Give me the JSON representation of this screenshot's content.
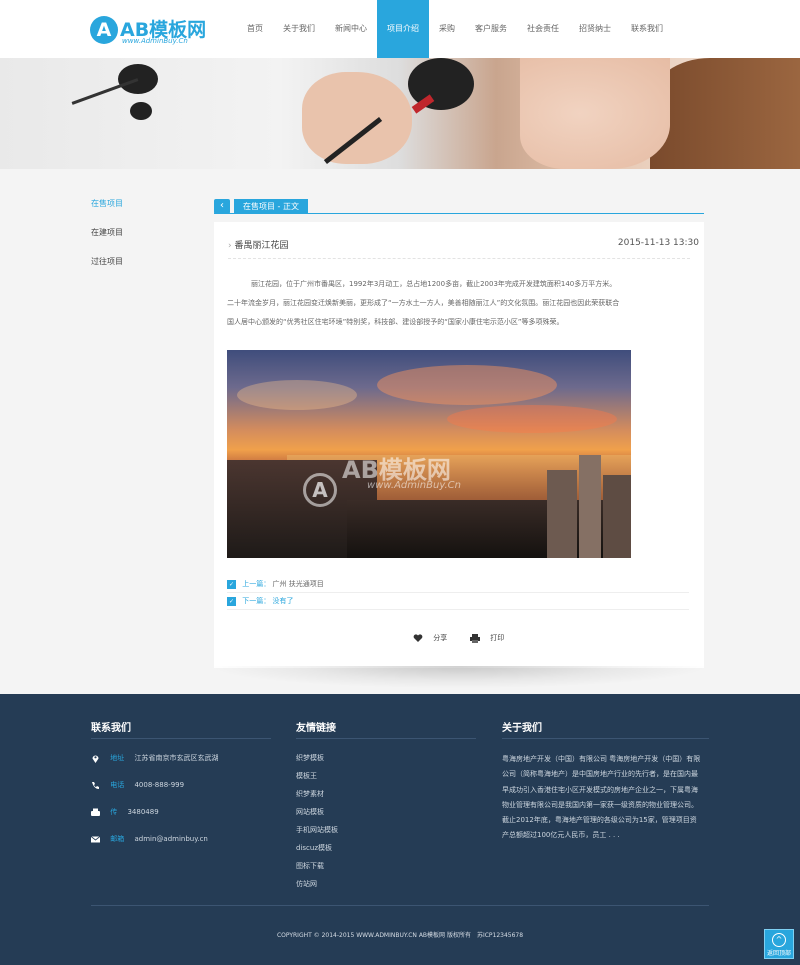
{
  "header": {
    "logo_badge": "A",
    "logo_text": "AB模板网",
    "logo_sub": "www.AdminBuy.Cn",
    "nav": [
      {
        "label": "首页",
        "active": false
      },
      {
        "label": "关于我们",
        "active": false
      },
      {
        "label": "新闻中心",
        "active": false
      },
      {
        "label": "项目介绍",
        "active": true
      },
      {
        "label": "采购",
        "active": false
      },
      {
        "label": "客户服务",
        "active": false
      },
      {
        "label": "社会责任",
        "active": false
      },
      {
        "label": "招贤纳士",
        "active": false
      },
      {
        "label": "联系我们",
        "active": false
      }
    ]
  },
  "sidebar": {
    "items": [
      {
        "label": "在售项目",
        "active": true
      },
      {
        "label": "在建项目",
        "active": false
      },
      {
        "label": "过往项目",
        "active": false
      }
    ]
  },
  "breadcrumb": {
    "label": "在售项目 - 正文"
  },
  "article": {
    "title": "番禺丽江花园",
    "date": "2015-11-13 13:30",
    "paragraphs": [
      "丽江花园，位于广州市番禺区，1992年3月动工，总占地1200多亩，截止2003年完成开发建筑面积140多万平方米。",
      "二十年流金岁月，丽江花园变迁焕新美丽，更形成了“一方水土一方人，美善相随丽江人”的文化氛围。丽江花园也因此荣获联合",
      "国人居中心颁发的“优秀社区住宅环境”特别奖，科技部、建设部授予的“国家小康住宅示范小区”等多项殊荣。"
    ],
    "watermark": {
      "badge": "A",
      "text": "AB模板网",
      "sub": "www.AdminBuy.Cn"
    },
    "prev": {
      "label": "上一篇：",
      "value": "广州 扶光通项目"
    },
    "next": {
      "label": "下一篇：",
      "value": "没有了"
    },
    "share_label": "分享",
    "print_label": "打印"
  },
  "footer": {
    "contact": {
      "title": "联系我们",
      "items": [
        {
          "icon": "location-icon",
          "label": "地址",
          "value": "江苏省南京市玄武区玄武湖"
        },
        {
          "icon": "phone-icon",
          "label": "电话",
          "value": "4008-888-999"
        },
        {
          "icon": "fax-icon",
          "label": "传",
          "value": "3480489"
        },
        {
          "icon": "mail-icon",
          "label": "邮箱",
          "value": "admin@adminbuy.cn"
        }
      ]
    },
    "links": {
      "title": "友情链接",
      "items": [
        "织梦模板",
        "模板王",
        "织梦素材",
        "网站模板",
        "手机网站模板",
        "discuz模板",
        "图标下载",
        "仿站网"
      ]
    },
    "about": {
      "title": "关于我们",
      "text": "粤海房地产开发（中国）有限公司 粤海房地产开发（中国）有限公司（简称粤海地产）是中国房地产行业的先行者，是在国内最早成功引入香港住宅小区开发模式的房地产企业之一，下属粤海物业管理有限公司是我国内第一家获一级资质的物业管理公司。截止2012年底，粤海地产管理的各级公司为15家，管理项目资产总额超过100亿元人民币，员工 . . ."
    },
    "copyright": "COPYRIGHT © 2014-2015 WWW.ADMINBUY.CN AB模板网 版权所有　苏ICP12345678",
    "back_top_label": "返回顶部"
  }
}
